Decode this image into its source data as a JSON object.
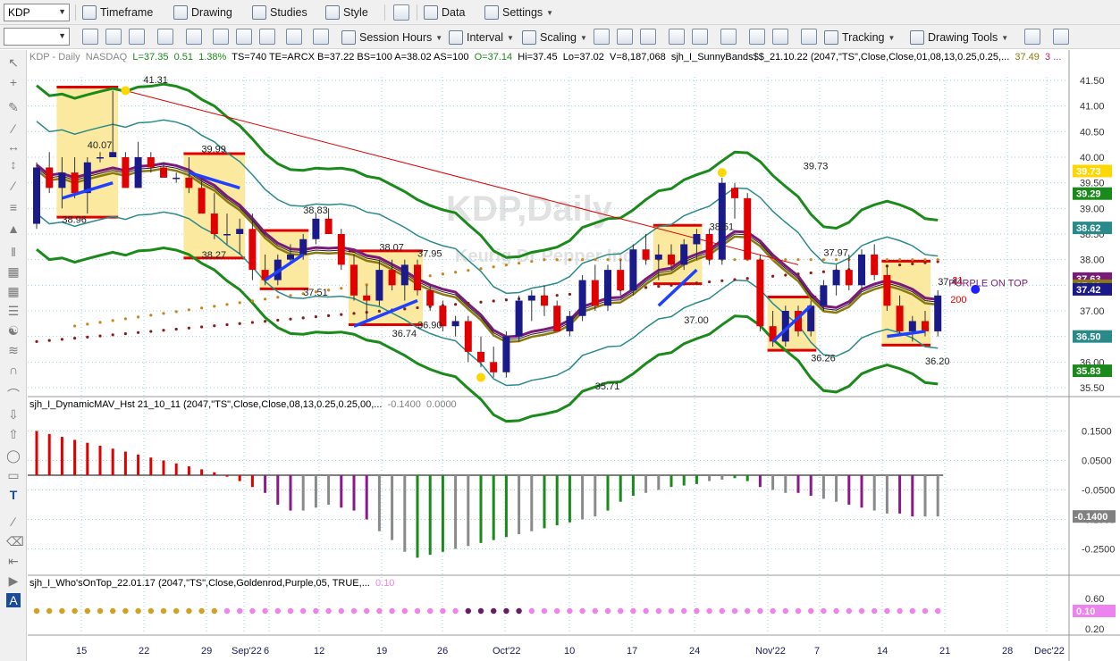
{
  "toolbar1": {
    "symbol": "KDP",
    "buttons": [
      {
        "label": "Timeframe"
      },
      {
        "label": "Drawing"
      },
      {
        "label": "Studies"
      },
      {
        "label": "Style"
      },
      {
        "label": "Data"
      },
      {
        "label": "Settings"
      }
    ]
  },
  "toolbar2": {
    "buttons": [
      {
        "label": "Session Hours"
      },
      {
        "label": "Interval"
      },
      {
        "label": "Scaling"
      },
      {
        "label": "Tracking"
      },
      {
        "label": "Drawing Tools"
      }
    ]
  },
  "header": {
    "symbol_info": "KDP - Daily",
    "exchange": "NASDAQ",
    "last": "L=37.35",
    "change": "0.51",
    "change_pct": "1.38%",
    "rest": "TS=740  TE=ARCX  B=37.22  BS=100  A=38.02  AS=100",
    "open": "O=37.14",
    "hi": "Hi=37.45",
    "lo": "Lo=37.02",
    "volume": "V=8,187,068",
    "study": "sjh_I_SunnyBands$$_21.10.22 (2047,\"TS\",Close,Close,01,08,13,0.25,0.25,...",
    "study_val": "37.49",
    "study_more": "3 ..."
  },
  "watermark": {
    "symbol": "KDP,Daily",
    "name": "Keurig Dr Pepper Inc"
  },
  "price_labels": [
    "41.31",
    "40.07",
    "39.99",
    "38.96",
    "38.27",
    "38.83",
    "37.51",
    "38.07",
    "37.95",
    "36.90",
    "36.74",
    "35.71",
    "38.51",
    "37.00",
    "39.73",
    "37.97",
    "36.26",
    "36.20",
    "37.44",
    "21",
    "200"
  ],
  "purple_on_top": "PURPLE ON TOP",
  "axis_badges": [
    {
      "text": "39.73",
      "color": "#ffd700",
      "fg": "#ffffff"
    },
    {
      "text": "39.29",
      "color": "#1a8a1a",
      "fg": "#ffffff"
    },
    {
      "text": "38.62",
      "color": "#2a8a8a",
      "fg": "#ffffff"
    },
    {
      "text": "37.63",
      "color": "#7a1a7a",
      "fg": "#ffffff"
    },
    {
      "text": "37.49",
      "color": "#8a7a10",
      "fg": "#ffffff"
    },
    {
      "text": "37.42",
      "color": "#1a1a8a",
      "fg": "#ffffff"
    },
    {
      "text": "36.50",
      "color": "#2a8a8a",
      "fg": "#ffffff"
    },
    {
      "text": "35.83",
      "color": "#1a8a1a",
      "fg": "#ffffff"
    },
    {
      "text": "-0.1400",
      "color": "#808080",
      "fg": "#ffffff"
    },
    {
      "text": "0.10",
      "color": "#ee82ee",
      "fg": "#ffffff"
    }
  ],
  "panel2": {
    "title": "sjh_I_DynamicMAV_Hst 21_10_11 (2047,\"TS\",Close,Close,08,13,0.25,0.25,00,...",
    "v1": "-0.1400",
    "v2": "0.0000"
  },
  "panel3": {
    "title": "sjh_I_Who'sOnTop_22.01.17 (2047,\"TS\",Close,Goldenrod,Purple,05, TRUE,...",
    "v1": "0.10"
  },
  "colors": {
    "up": "#1a1a8a",
    "down": "#e00000",
    "green_band": "#1a8a1a",
    "teal_band": "#2a8a8a",
    "purple": "#7a1a7a",
    "olive": "#8a7a10",
    "box": "#fbe9a0"
  },
  "chart_data": {
    "type": "candlestick",
    "price_axis": {
      "min": 35.5,
      "max": 41.5,
      "ticks": [
        "41.50",
        "41.00",
        "40.50",
        "40.00",
        "39.50",
        "39.00",
        "38.50",
        "38.00",
        "37.50",
        "37.00",
        "36.50",
        "36.00",
        "35.50"
      ]
    },
    "mav_axis": {
      "min": -0.3,
      "max": 0.2,
      "ticks": [
        "0.1500",
        "0.0500",
        "-0.0500",
        "-0.1500",
        "-0.2500"
      ]
    },
    "top_axis": {
      "ticks": [
        "0.60",
        "0.20"
      ]
    },
    "x_labels": [
      "15",
      "22",
      "29",
      "Sep'22",
      "6",
      "12",
      "19",
      "26",
      "Oct'22",
      "10",
      "17",
      "24",
      "Nov'22",
      "7",
      "14",
      "21",
      "28",
      "Dec'22"
    ],
    "candles": [
      [
        38.7,
        39.9,
        38.6,
        39.8
      ],
      [
        39.8,
        40.1,
        39.3,
        39.4
      ],
      [
        39.4,
        40.0,
        39.0,
        39.7
      ],
      [
        39.7,
        40.0,
        39.2,
        39.3
      ],
      [
        39.3,
        40.0,
        38.9,
        39.9
      ],
      [
        40.0,
        40.1,
        39.9,
        40.0
      ],
      [
        40.0,
        41.3,
        40.0,
        40.1
      ],
      [
        40.0,
        40.1,
        39.4,
        39.4
      ],
      [
        39.4,
        40.3,
        39.4,
        40.0
      ],
      [
        40.0,
        40.1,
        39.7,
        39.8
      ],
      [
        39.8,
        39.9,
        39.6,
        39.6
      ],
      [
        39.6,
        39.7,
        39.5,
        39.6
      ],
      [
        39.6,
        40.0,
        39.3,
        39.4
      ],
      [
        39.4,
        39.6,
        38.9,
        38.9
      ],
      [
        38.9,
        39.3,
        38.4,
        38.5
      ],
      [
        38.5,
        38.9,
        38.3,
        38.5
      ],
      [
        38.5,
        38.8,
        38.1,
        38.6
      ],
      [
        38.6,
        38.9,
        37.6,
        37.8
      ],
      [
        37.8,
        38.1,
        37.5,
        37.6
      ],
      [
        37.6,
        38.1,
        37.5,
        38.0
      ],
      [
        38.0,
        38.3,
        37.9,
        38.1
      ],
      [
        38.1,
        38.5,
        38.0,
        38.4
      ],
      [
        38.4,
        38.9,
        38.3,
        38.8
      ],
      [
        38.8,
        39.0,
        38.5,
        38.5
      ],
      [
        38.5,
        38.6,
        37.8,
        37.9
      ],
      [
        37.9,
        38.1,
        37.2,
        37.3
      ],
      [
        37.3,
        37.5,
        36.8,
        37.2
      ],
      [
        37.2,
        38.0,
        37.1,
        37.8
      ],
      [
        37.8,
        38.0,
        37.4,
        37.5
      ],
      [
        37.5,
        38.0,
        37.2,
        37.9
      ],
      [
        37.9,
        38.0,
        37.3,
        37.4
      ],
      [
        37.4,
        37.5,
        37.0,
        37.1
      ],
      [
        37.1,
        37.2,
        36.6,
        36.7
      ],
      [
        36.7,
        36.9,
        36.5,
        36.8
      ],
      [
        36.8,
        36.9,
        36.0,
        36.2
      ],
      [
        36.2,
        36.5,
        35.9,
        36.0
      ],
      [
        36.0,
        36.3,
        35.7,
        35.8
      ],
      [
        35.8,
        36.6,
        35.7,
        36.5
      ],
      [
        36.5,
        37.3,
        36.4,
        37.2
      ],
      [
        37.2,
        37.4,
        36.8,
        37.3
      ],
      [
        37.3,
        37.5,
        36.9,
        37.1
      ],
      [
        37.1,
        37.2,
        36.6,
        36.6
      ],
      [
        36.6,
        37.0,
        36.5,
        36.9
      ],
      [
        36.9,
        37.7,
        36.8,
        37.6
      ],
      [
        37.6,
        37.9,
        37.0,
        37.1
      ],
      [
        37.1,
        37.9,
        37.0,
        37.8
      ],
      [
        37.8,
        38.0,
        37.3,
        37.4
      ],
      [
        37.4,
        38.3,
        37.3,
        38.2
      ],
      [
        38.2,
        38.5,
        37.9,
        38.0
      ],
      [
        38.0,
        38.3,
        37.6,
        38.1
      ],
      [
        38.1,
        38.3,
        37.8,
        37.9
      ],
      [
        37.9,
        38.4,
        37.8,
        38.3
      ],
      [
        38.3,
        38.6,
        38.0,
        38.5
      ],
      [
        38.5,
        38.6,
        37.9,
        38.0
      ],
      [
        38.0,
        39.6,
        37.9,
        39.5
      ],
      [
        39.4,
        39.5,
        38.8,
        39.2
      ],
      [
        39.2,
        39.3,
        38.0,
        38.0
      ],
      [
        38.0,
        38.1,
        36.6,
        36.7
      ],
      [
        36.7,
        37.0,
        36.3,
        36.4
      ],
      [
        36.4,
        37.1,
        36.3,
        37.0
      ],
      [
        37.0,
        37.1,
        36.5,
        36.6
      ],
      [
        36.6,
        37.2,
        36.5,
        37.1
      ],
      [
        37.1,
        37.6,
        37.0,
        37.5
      ],
      [
        37.5,
        37.9,
        37.3,
        37.8
      ],
      [
        37.8,
        38.1,
        37.4,
        37.5
      ],
      [
        37.5,
        38.2,
        37.4,
        38.1
      ],
      [
        38.1,
        38.3,
        37.6,
        37.7
      ],
      [
        37.7,
        37.9,
        37.0,
        37.1
      ],
      [
        37.1,
        37.3,
        36.5,
        36.6
      ],
      [
        36.6,
        36.9,
        36.4,
        36.8
      ],
      [
        36.8,
        37.0,
        36.5,
        36.6
      ],
      [
        36.6,
        37.4,
        36.5,
        37.3
      ]
    ],
    "mav_hist": [
      0.15,
      0.14,
      0.13,
      0.12,
      0.11,
      0.1,
      0.09,
      0.08,
      0.07,
      0.06,
      0.05,
      0.04,
      0.03,
      0.02,
      0.01,
      -0.005,
      -0.02,
      -0.04,
      -0.06,
      -0.1,
      -0.12,
      -0.12,
      -0.11,
      -0.1,
      -0.11,
      -0.12,
      -0.15,
      -0.19,
      -0.22,
      -0.26,
      -0.28,
      -0.27,
      -0.26,
      -0.25,
      -0.24,
      -0.23,
      -0.22,
      -0.21,
      -0.2,
      -0.19,
      -0.18,
      -0.17,
      -0.16,
      -0.15,
      -0.14,
      -0.12,
      -0.09,
      -0.07,
      -0.06,
      -0.05,
      -0.04,
      -0.035,
      -0.03,
      -0.02,
      -0.015,
      -0.01,
      -0.02,
      -0.04,
      -0.05,
      -0.06,
      -0.06,
      -0.07,
      -0.08,
      -0.09,
      -0.1,
      -0.11,
      -0.12,
      -0.13,
      -0.13,
      -0.14,
      -0.14,
      -0.14
    ]
  }
}
